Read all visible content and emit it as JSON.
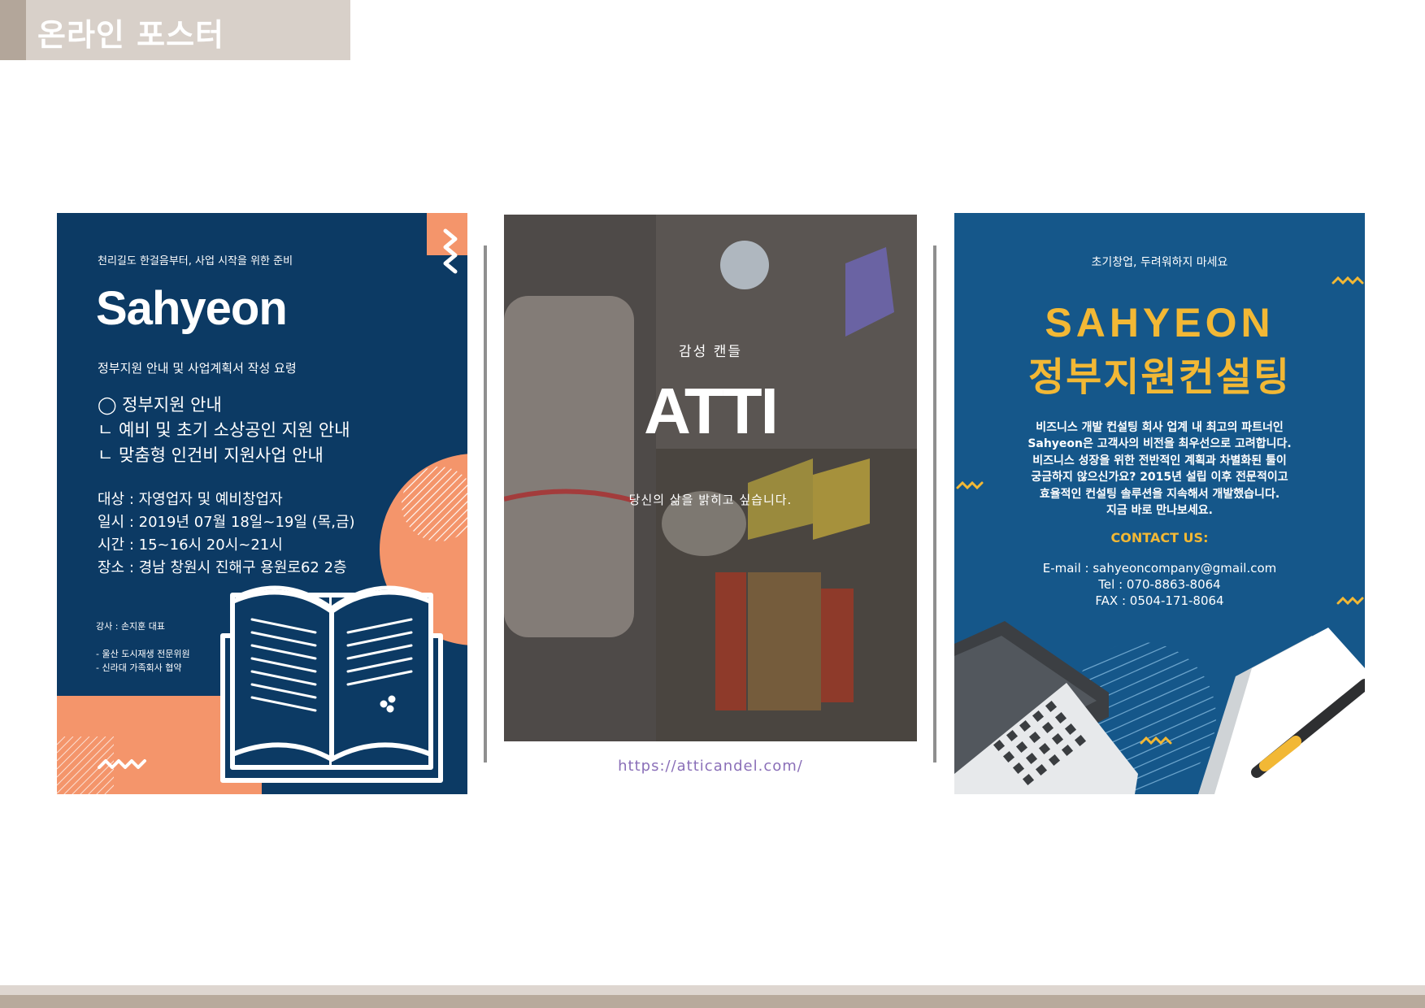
{
  "header": {
    "title": "온라인 포스터"
  },
  "poster1": {
    "tagline": "천리길도 한걸음부터, 사업 시작을 위한 준비",
    "title": "Sahyeon",
    "subtitle": "정부지원 안내 및 사업계획서 작성 요령",
    "list": [
      "◯ 정부지원 안내",
      "ㄴ 예비 및 초기 소상공인 지원 안내",
      "ㄴ 맞춤형 인건비 지원사업 안내"
    ],
    "info": [
      "대상 : 자영업자 및 예비창업자",
      "일시 : 2019년 07월 18일~19일 (목,금)",
      "시간 : 15~16시 20시~21시",
      "장소 : 경남 창원시 진해구 용원로62 2층"
    ],
    "lecturer": "강사 : 손지훈 대표",
    "credentials": [
      "- 울산 도시재생 전문위원",
      "- 신라대 가족회사 협약"
    ]
  },
  "poster2": {
    "kicker": "감성 캔들",
    "brand": "ATTI",
    "slogan": "당신의 삶을 밝히고 싶습니다.",
    "url": "https://atticandel.com/"
  },
  "poster3": {
    "tagline": "초기창업, 두려워하지 마세요",
    "title1": "SAHYEON",
    "title2": "정부지원컨설팅",
    "body": [
      "비즈니스 개발 컨설팅 회사 업계 내 최고의 파트너인",
      "Sahyeon은 고객사의 비전을 최우선으로 고려합니다.",
      "비즈니스 성장을 위한 전반적인 계획과 차별화된 툴이",
      "궁금하지 않으신가요? 2015년 설립 이후 전문적이고",
      "효율적인 컨설팅 솔루션을 지속해서 개발했습니다.",
      "지금 바로 만나보세요."
    ],
    "contact_heading": "CONTACT US:",
    "email": "E-mail : sahyeoncompany@gmail.com",
    "tel": "Tel : 070-8863-8064",
    "fax": "FAX : 0504-171-8064"
  },
  "colors": {
    "header_tab": "#b3a69a",
    "header_bar": "#d8d0c9",
    "poster1_bg": "#0c3a64",
    "poster1_accent": "#f4956b",
    "poster3_bg": "#15578a",
    "poster3_accent": "#f2b835",
    "url_color": "#8a6fb8"
  }
}
